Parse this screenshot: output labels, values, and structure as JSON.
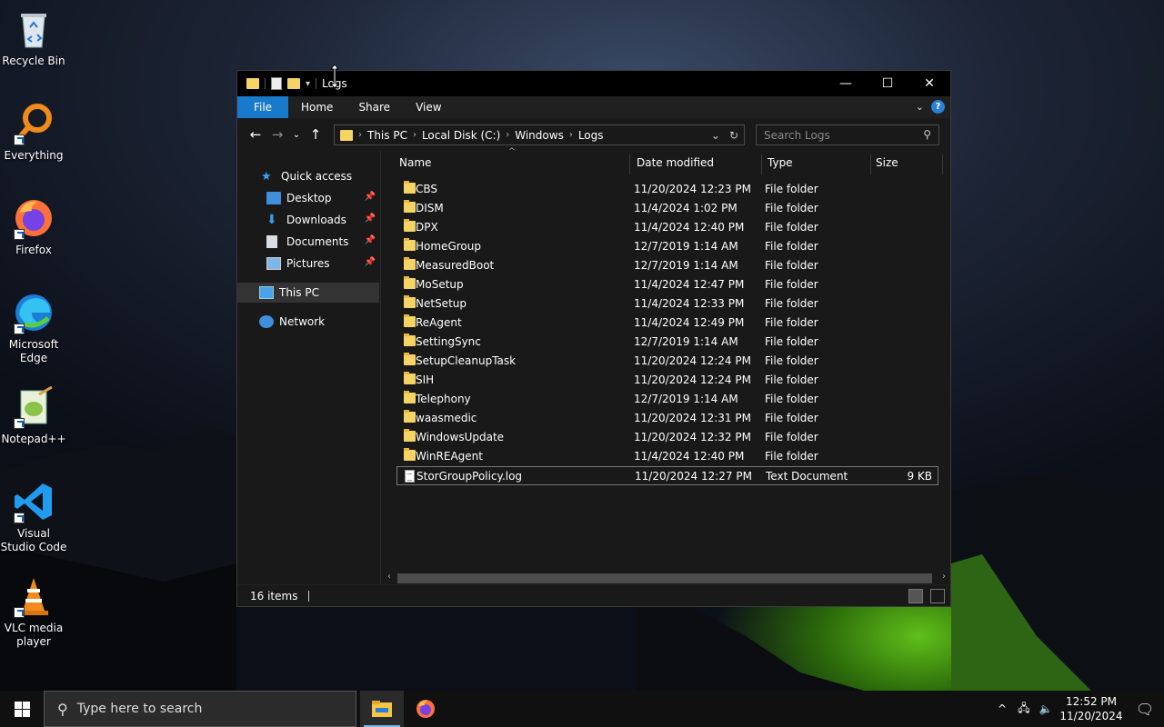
{
  "desktop": {
    "icons": [
      {
        "label": "Recycle Bin"
      },
      {
        "label": "Everything"
      },
      {
        "label": "Firefox"
      },
      {
        "label": "Microsoft Edge"
      },
      {
        "label": "Notepad++"
      },
      {
        "label": "Visual Studio Code"
      },
      {
        "label": "VLC media player"
      }
    ]
  },
  "window": {
    "title": "Logs",
    "ribbon_tabs": [
      "File",
      "Home",
      "Share",
      "View"
    ],
    "breadcrumb": [
      "This PC",
      "Local Disk (C:)",
      "Windows",
      "Logs"
    ],
    "search_placeholder": "Search Logs",
    "nav": {
      "quick_access": "Quick access",
      "items": [
        "Desktop",
        "Downloads",
        "Documents",
        "Pictures"
      ],
      "this_pc": "This PC",
      "network": "Network"
    },
    "columns": [
      "Name",
      "Date modified",
      "Type",
      "Size"
    ],
    "files": [
      {
        "name": "CBS",
        "date": "11/20/2024 12:23 PM",
        "type": "File folder",
        "size": ""
      },
      {
        "name": "DISM",
        "date": "11/4/2024 1:02 PM",
        "type": "File folder",
        "size": ""
      },
      {
        "name": "DPX",
        "date": "11/4/2024 12:40 PM",
        "type": "File folder",
        "size": ""
      },
      {
        "name": "HomeGroup",
        "date": "12/7/2019 1:14 AM",
        "type": "File folder",
        "size": ""
      },
      {
        "name": "MeasuredBoot",
        "date": "12/7/2019 1:14 AM",
        "type": "File folder",
        "size": ""
      },
      {
        "name": "MoSetup",
        "date": "11/4/2024 12:47 PM",
        "type": "File folder",
        "size": ""
      },
      {
        "name": "NetSetup",
        "date": "11/4/2024 12:33 PM",
        "type": "File folder",
        "size": ""
      },
      {
        "name": "ReAgent",
        "date": "11/4/2024 12:49 PM",
        "type": "File folder",
        "size": ""
      },
      {
        "name": "SettingSync",
        "date": "12/7/2019 1:14 AM",
        "type": "File folder",
        "size": ""
      },
      {
        "name": "SetupCleanupTask",
        "date": "11/20/2024 12:24 PM",
        "type": "File folder",
        "size": ""
      },
      {
        "name": "SIH",
        "date": "11/20/2024 12:24 PM",
        "type": "File folder",
        "size": ""
      },
      {
        "name": "Telephony",
        "date": "12/7/2019 1:14 AM",
        "type": "File folder",
        "size": ""
      },
      {
        "name": "waasmedic",
        "date": "11/20/2024 12:31 PM",
        "type": "File folder",
        "size": ""
      },
      {
        "name": "WindowsUpdate",
        "date": "11/20/2024 12:32 PM",
        "type": "File folder",
        "size": ""
      },
      {
        "name": "WinREAgent",
        "date": "11/4/2024 12:40 PM",
        "type": "File folder",
        "size": ""
      },
      {
        "name": "StorGroupPolicy.log",
        "date": "11/20/2024 12:27 PM",
        "type": "Text Document",
        "size": "9 KB"
      }
    ],
    "status": "16 items"
  },
  "taskbar": {
    "search_placeholder": "Type here to search",
    "time": "12:52 PM",
    "date": "11/20/2024"
  },
  "colors": {
    "accent": "#1979ca",
    "folder": "#f6d365",
    "window_bg": "#191919"
  }
}
